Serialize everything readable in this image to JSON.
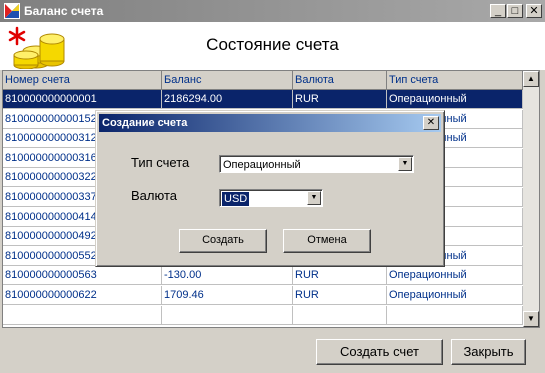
{
  "window": {
    "title": "Баланс счета",
    "icon": "app-icon",
    "controls": {
      "minimize": "_",
      "maximize": "□",
      "close": "✕"
    }
  },
  "header": {
    "title": "Состояние счета",
    "icon": "coins-icon"
  },
  "table": {
    "columns": [
      "Номер счета",
      "Баланс",
      "Валюта",
      "Тип счета"
    ],
    "rows": [
      {
        "account": "810000000000001",
        "balance": "2186294.00",
        "currency": "RUR",
        "type": "Операционный",
        "selected": true
      },
      {
        "account": "810000000000152",
        "balance": "",
        "currency": "",
        "type": "Операционный"
      },
      {
        "account": "810000000000312",
        "balance": "",
        "currency": "",
        "type": "Операционный"
      },
      {
        "account": "810000000000316",
        "balance": "",
        "currency": "",
        "type": ""
      },
      {
        "account": "810000000000322",
        "balance": "",
        "currency": "",
        "type": ""
      },
      {
        "account": "810000000000337",
        "balance": "",
        "currency": "",
        "type": ""
      },
      {
        "account": "810000000000414",
        "balance": "",
        "currency": "",
        "type": ""
      },
      {
        "account": "810000000000492",
        "balance": "",
        "currency": "",
        "type": ""
      },
      {
        "account": "810000000000552",
        "balance": "5.04",
        "currency": "RUR",
        "type": "Операционный"
      },
      {
        "account": "810000000000563",
        "balance": "-130.00",
        "currency": "RUR",
        "type": "Операционный"
      },
      {
        "account": "810000000000622",
        "balance": "1709.46",
        "currency": "RUR",
        "type": "Операционный"
      },
      {
        "account": "",
        "balance": "",
        "currency": "",
        "type": ""
      }
    ]
  },
  "buttons": {
    "create_account": "Создать счет",
    "close": "Закрыть"
  },
  "dialog": {
    "title": "Создание счета",
    "close_glyph": "✕",
    "type_label": "Тип счета",
    "type_value": "Операционный",
    "currency_label": "Валюта",
    "currency_value": "USD",
    "create_button": "Создать",
    "cancel_button": "Отмена"
  },
  "colors": {
    "selection": "#0a246a",
    "cell_text": "#00308a",
    "window_bg": "#d4d0c8"
  }
}
